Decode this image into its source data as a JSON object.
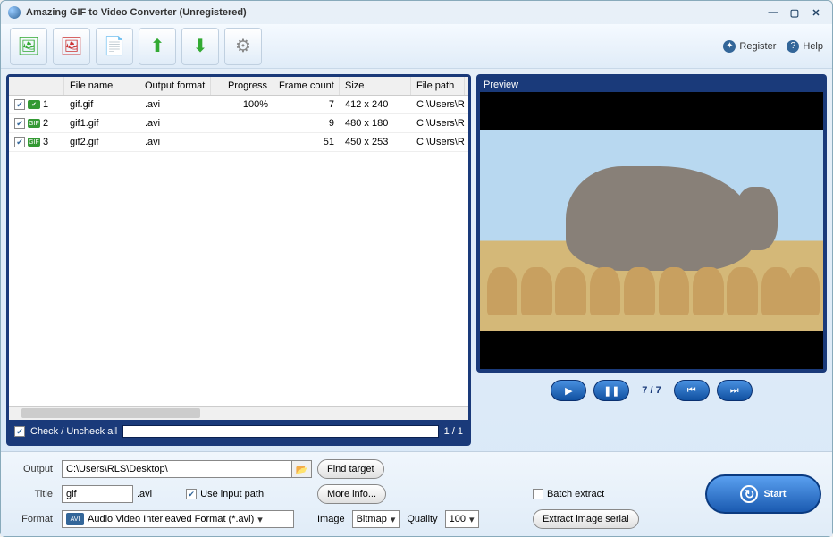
{
  "window": {
    "title": "Amazing GIF to Video Converter (Unregistered)"
  },
  "header_links": {
    "register": "Register",
    "help": "Help"
  },
  "columns": {
    "filename": "File name",
    "output_format": "Output format",
    "progress": "Progress",
    "frame_count": "Frame count",
    "size": "Size",
    "file_path": "File path"
  },
  "rows": [
    {
      "idx": "1",
      "name": "gif.gif",
      "fmt": ".avi",
      "progress": "100%",
      "frames": "7",
      "size": "412 x 240",
      "path": "C:\\Users\\R",
      "done": true
    },
    {
      "idx": "2",
      "name": "gif1.gif",
      "fmt": ".avi",
      "progress": "",
      "frames": "9",
      "size": "480 x 180",
      "path": "C:\\Users\\R",
      "done": false
    },
    {
      "idx": "3",
      "name": "gif2.gif",
      "fmt": ".avi",
      "progress": "",
      "frames": "51",
      "size": "450 x 253",
      "path": "C:\\Users\\R",
      "done": false
    }
  ],
  "check_all": "Check / Uncheck all",
  "page_count": "1 / 1",
  "preview": {
    "label": "Preview",
    "counter": "7 / 7"
  },
  "output": {
    "label": "Output",
    "path": "C:\\Users\\RLS\\Desktop\\",
    "find_target": "Find target",
    "title_label": "Title",
    "title_value": "gif",
    "title_ext": ".avi",
    "use_input_path": "Use input path",
    "more_info": "More info...",
    "format_label": "Format",
    "format_value": "Audio Video Interleaved Format (*.avi)",
    "image_label": "Image",
    "image_value": "Bitmap",
    "quality_label": "Quality",
    "quality_value": "100",
    "batch_extract": "Batch extract",
    "extract_serial": "Extract image serial",
    "start": "Start"
  }
}
